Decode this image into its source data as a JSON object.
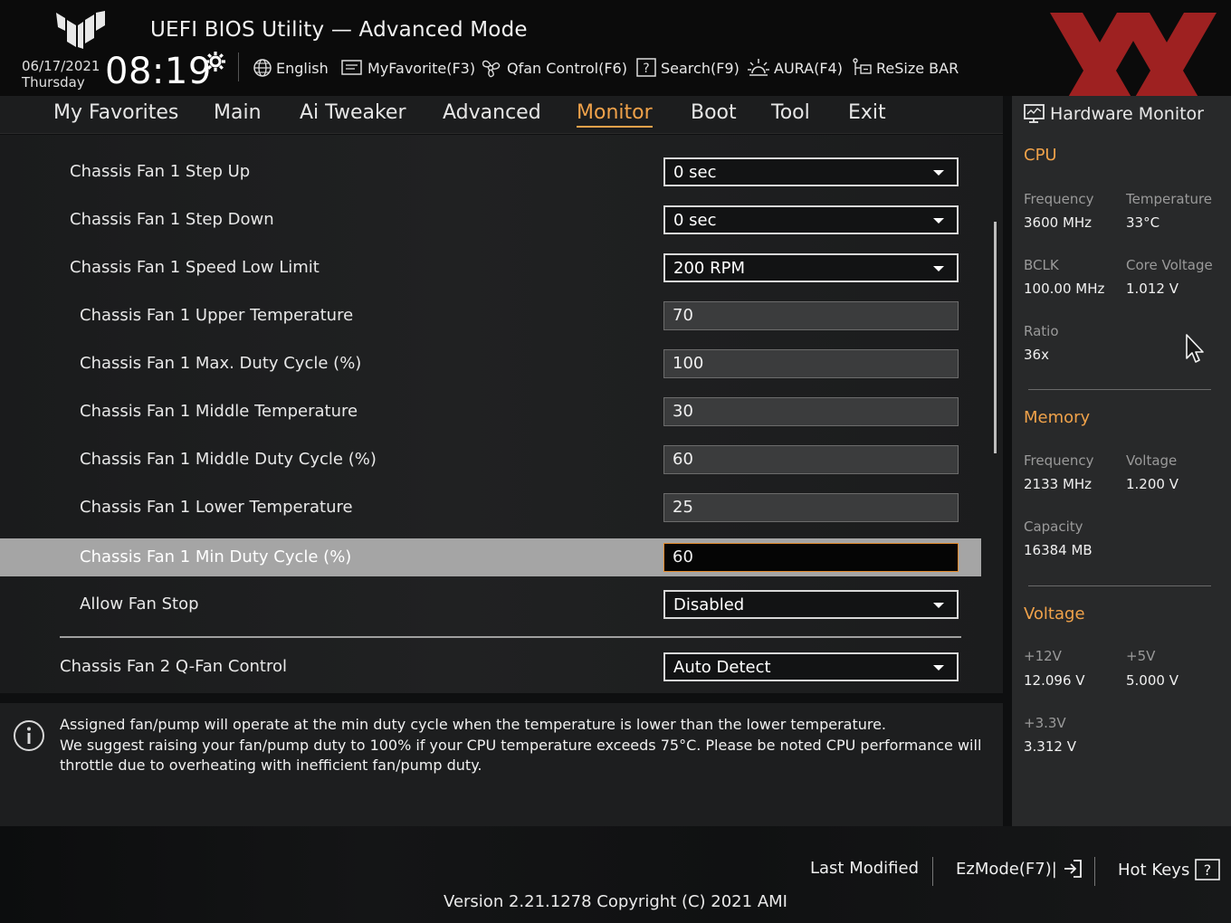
{
  "header": {
    "title": "UEFI BIOS Utility — Advanced Mode",
    "date": "06/17/2021",
    "weekday": "Thursday",
    "time": "08:19",
    "tools": [
      {
        "label": "English",
        "icon": "globe-icon"
      },
      {
        "label": "MyFavorite(F3)",
        "icon": "favorite-icon"
      },
      {
        "label": "Qfan Control(F6)",
        "icon": "fan-icon"
      },
      {
        "label": "Search(F9)",
        "icon": "search-help-icon"
      },
      {
        "label": "AURA(F4)",
        "icon": "aura-light-icon"
      },
      {
        "label": "ReSize BAR",
        "icon": "resize-bar-icon"
      }
    ]
  },
  "nav": {
    "tabs": [
      "My Favorites",
      "Main",
      "Ai Tweaker",
      "Advanced",
      "Monitor",
      "Boot",
      "Tool",
      "Exit"
    ],
    "active": "Monitor"
  },
  "settings": [
    {
      "label": "Chassis Fan 1 Step Up",
      "type": "dropdown",
      "value": "0 sec"
    },
    {
      "label": "Chassis Fan 1 Step Down",
      "type": "dropdown",
      "value": "0 sec"
    },
    {
      "label": "Chassis Fan 1 Speed Low Limit",
      "type": "dropdown",
      "value": "200 RPM"
    },
    {
      "label": "Chassis Fan 1 Upper Temperature",
      "type": "field",
      "value": "70"
    },
    {
      "label": "Chassis Fan 1 Max. Duty Cycle (%)",
      "type": "field",
      "value": "100"
    },
    {
      "label": "Chassis Fan 1 Middle Temperature",
      "type": "field",
      "value": "30"
    },
    {
      "label": "Chassis Fan 1 Middle Duty Cycle (%)",
      "type": "field",
      "value": "60"
    },
    {
      "label": "Chassis Fan 1 Lower Temperature",
      "type": "field",
      "value": "25"
    },
    {
      "label": "Chassis Fan 1 Min Duty Cycle (%)",
      "type": "field",
      "value": "60",
      "selected": true
    },
    {
      "label": "Allow Fan Stop",
      "type": "dropdown",
      "value": "Disabled"
    },
    {
      "label": "Chassis Fan 2 Q-Fan Control",
      "type": "dropdown",
      "value": "Auto Detect"
    }
  ],
  "help": {
    "lines": [
      "Assigned fan/pump will operate at the min duty cycle when the temperature is lower than the lower temperature.",
      "We suggest raising your fan/pump duty to 100% if your CPU temperature exceeds 75°C. Please be noted CPU performance will",
      "throttle due to overheating with inefficient fan/pump duty."
    ]
  },
  "hardware_monitor": {
    "title": "Hardware Monitor",
    "cpu": {
      "heading": "CPU",
      "frequency_label": "Frequency",
      "frequency": "3600 MHz",
      "temperature_label": "Temperature",
      "temperature": "33°C",
      "bclk_label": "BCLK",
      "bclk": "100.00 MHz",
      "core_voltage_label": "Core Voltage",
      "core_voltage": "1.012 V",
      "ratio_label": "Ratio",
      "ratio": "36x"
    },
    "memory": {
      "heading": "Memory",
      "frequency_label": "Frequency",
      "frequency": "2133 MHz",
      "voltage_label": "Voltage",
      "voltage": "1.200 V",
      "capacity_label": "Capacity",
      "capacity": "16384 MB"
    },
    "voltage": {
      "heading": "Voltage",
      "v12_label": "+12V",
      "v12": "12.096 V",
      "v5_label": "+5V",
      "v5": "5.000 V",
      "v33_label": "+3.3V",
      "v33": "3.312 V"
    }
  },
  "footer": {
    "last_modified": "Last Modified",
    "ezmode": "EzMode(F7)|",
    "hotkeys": "Hot Keys",
    "version": "Version 2.21.1278 Copyright (C) 2021 AMI"
  },
  "colors": {
    "accent": "#f0a24a",
    "background": "#0e0f10",
    "panel": "#1c1d1e",
    "monitor_panel": "#28292a",
    "selected_row": "#a5a5a5",
    "brand_mark": "#c62828"
  }
}
